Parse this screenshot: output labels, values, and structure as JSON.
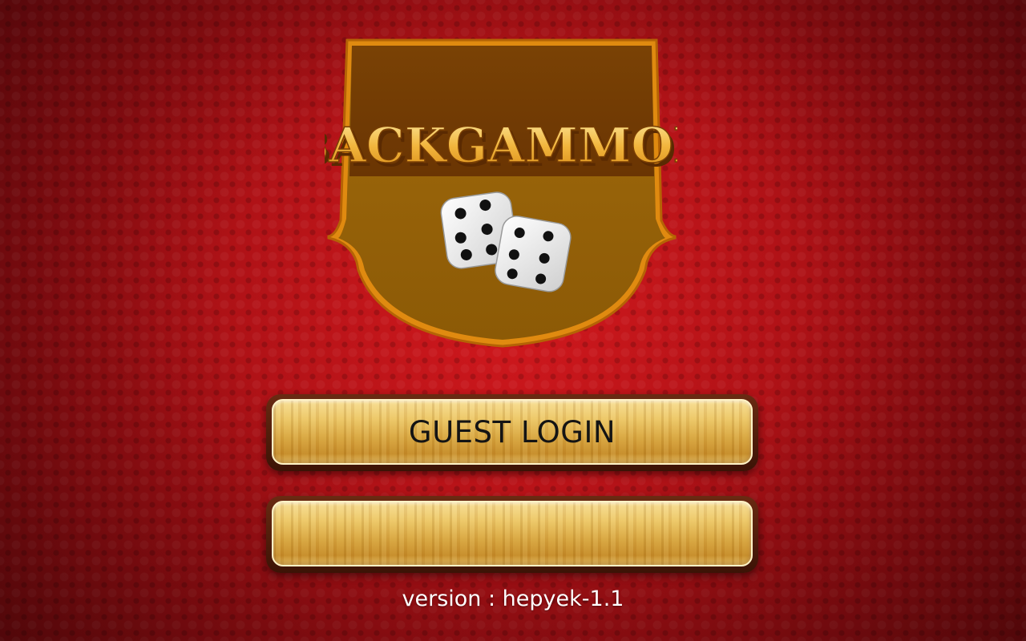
{
  "logo": {
    "title": "BACKGAMMON",
    "image": "backgammon-logo-with-dice"
  },
  "buttons": {
    "guest_login": "GUEST LOGIN",
    "second": ""
  },
  "footer": {
    "version": "version : hepyek-1.1"
  },
  "colors": {
    "background": "#b81218",
    "button_gold": "#e8bf5e",
    "button_border": "#4a1a08",
    "logo_brown": "#6e3d04",
    "logo_gold": "#b07c10"
  }
}
